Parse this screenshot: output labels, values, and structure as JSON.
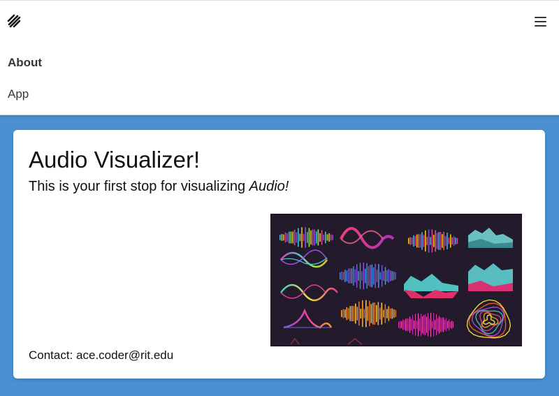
{
  "navbar": {
    "logo_icon": "slanted-stripes-logo-icon",
    "menu_icon": "hamburger-menu-icon"
  },
  "menu": {
    "items": [
      {
        "label": "About",
        "active": true
      },
      {
        "label": "App",
        "active": false
      }
    ]
  },
  "hero": {
    "title": "Audio Visualizer!",
    "subtitle_text": "This is your first stop for visualizing ",
    "subtitle_emphasis": "Audio!",
    "image_semantic": "audio-waveform-collage",
    "contact": "Contact: ace.coder@rit.edu"
  },
  "colors": {
    "page_background": "#4a90d2",
    "card_background": "#ffffff",
    "image_background": "#231b2b"
  }
}
